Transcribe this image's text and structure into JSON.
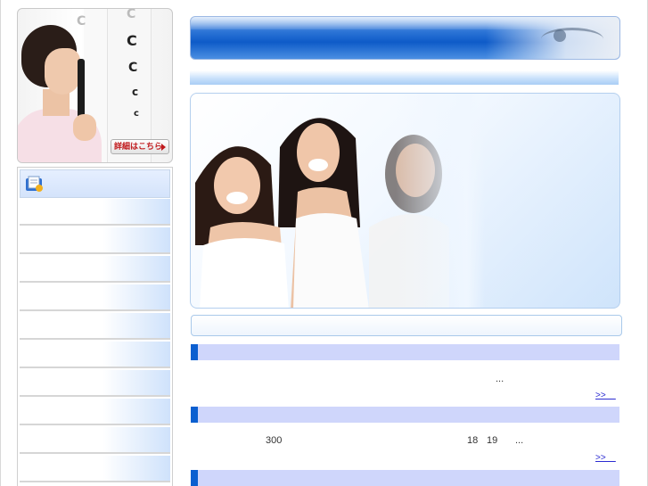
{
  "left_banner": {
    "button_label": "詳細はこちら",
    "chart_symbols": [
      "C",
      "C",
      "C",
      "C",
      "c",
      "c"
    ]
  },
  "left_menu": {
    "header_icon": "folder-document-icon",
    "item_count": 10
  },
  "articles": [
    {
      "text_fragments": [
        "..."
      ],
      "more_link": ">>    "
    },
    {
      "text_fragments": [
        "300",
        "18",
        "19",
        "..."
      ],
      "more_link": ">>    "
    }
  ],
  "colors": {
    "title_blue": "#0e5bc8",
    "section_head": "#cfd6fb",
    "section_marker": "#0b5fd0",
    "link": "#2b2bd1",
    "button_text": "#c0181b"
  }
}
